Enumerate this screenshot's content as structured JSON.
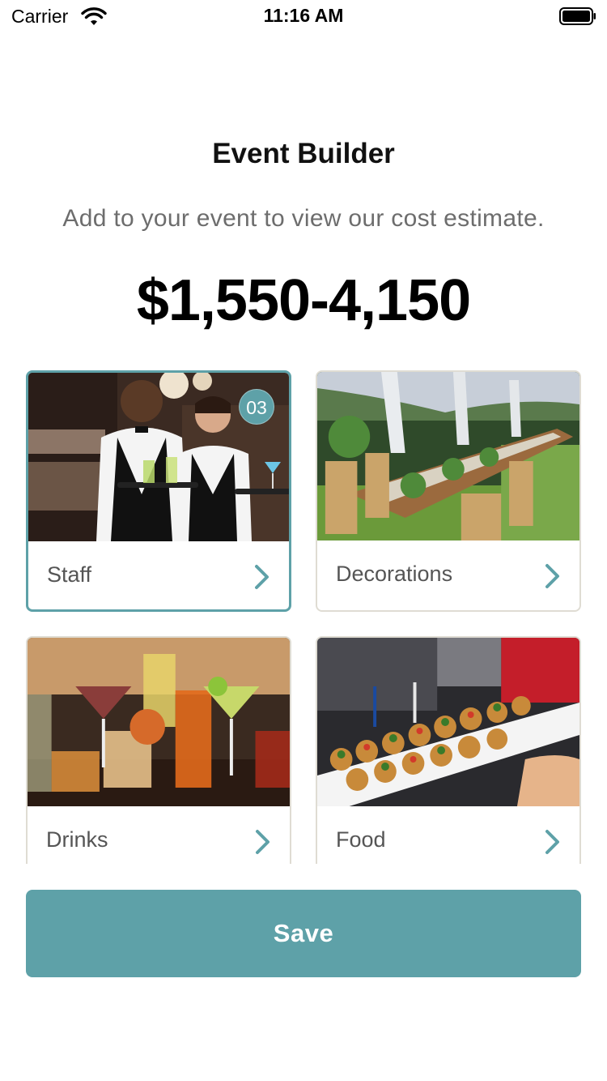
{
  "status_bar": {
    "carrier": "Carrier",
    "time": "11:16 AM"
  },
  "header": {
    "title": "Event Builder",
    "subtitle": "Add to your event to view our cost estimate.",
    "estimate": "$1,550-4,150"
  },
  "categories": [
    {
      "label": "Staff",
      "badge": "03",
      "selected": true,
      "image": "waiters-photo"
    },
    {
      "label": "Decorations",
      "selected": false,
      "image": "banquet-table-photo"
    },
    {
      "label": "Drinks",
      "selected": false,
      "image": "cocktails-photo"
    },
    {
      "label": "Food",
      "selected": false,
      "image": "canapes-photo"
    }
  ],
  "save_label": "Save",
  "colors": {
    "accent": "#5ea1a8",
    "card_border": "#dfdcd3",
    "subtitle": "#6d6d6d"
  }
}
